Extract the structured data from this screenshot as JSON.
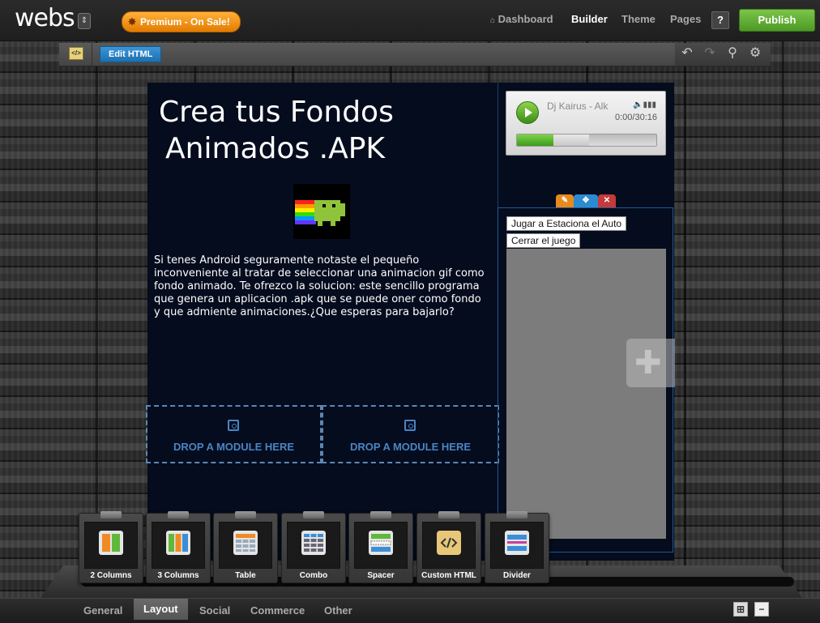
{
  "topbar": {
    "logo": "webs",
    "logo_menu": "⇕",
    "premium_label": "Premium - On Sale!",
    "nav": {
      "dashboard": "Dashboard",
      "builder": "Builder",
      "theme": "Theme",
      "pages": "Pages"
    },
    "help": "?",
    "publish": "Publish"
  },
  "toolbar": {
    "code_glyph": "</>",
    "edit_html": "Edit HTML",
    "icons": [
      "undo-icon",
      "redo-icon",
      "search-icon",
      "gear-icon"
    ]
  },
  "page": {
    "title_line1": "Crea  tus Fondos",
    "title_line2": "Animados .APK",
    "paragraph": "Si tenes Android seguramente notaste el pequeño inconveniente al tratar de seleccionar una animacion gif como fondo animado. Te ofrezco la solucion: este sencillo programa que genera un aplicacion .apk que se puede oner como fondo y que admiente animaciones.¿Que esperas para bajarlo?",
    "drop_zones": [
      "DROP A MODULE HERE",
      "DROP A MODULE HERE"
    ]
  },
  "player": {
    "track": "Dj Kairus - Alk",
    "time": "0:00/30:16",
    "progress_fraction": 0.26
  },
  "widget_tabs": {
    "edit": "✎",
    "move": "✥",
    "delete": "✕"
  },
  "game": {
    "button1": "Jugar a Estaciona el Auto",
    "button2": "Cerrar el juego"
  },
  "modules": [
    {
      "label": "2 Columns",
      "icon": "two-columns-icon"
    },
    {
      "label": "3 Columns",
      "icon": "three-columns-icon"
    },
    {
      "label": "Table",
      "icon": "table-icon"
    },
    {
      "label": "Combo",
      "icon": "combo-icon"
    },
    {
      "label": "Spacer",
      "icon": "spacer-icon"
    },
    {
      "label": "Custom HTML",
      "icon": "custom-html-icon"
    },
    {
      "label": "Divider",
      "icon": "divider-icon"
    }
  ],
  "bottom_tabs": {
    "general": "General",
    "layout": "Layout",
    "social": "Social",
    "commerce": "Commerce",
    "other": "Other"
  },
  "bottom_right": {
    "grid": "⊞",
    "minimize": "−"
  },
  "colors": {
    "publish": "#5aaa2e",
    "premium": "#f29a1a",
    "edit_html": "#2a84c8",
    "page_bg": "#050c1e",
    "drop_accent": "#4a85c4"
  }
}
